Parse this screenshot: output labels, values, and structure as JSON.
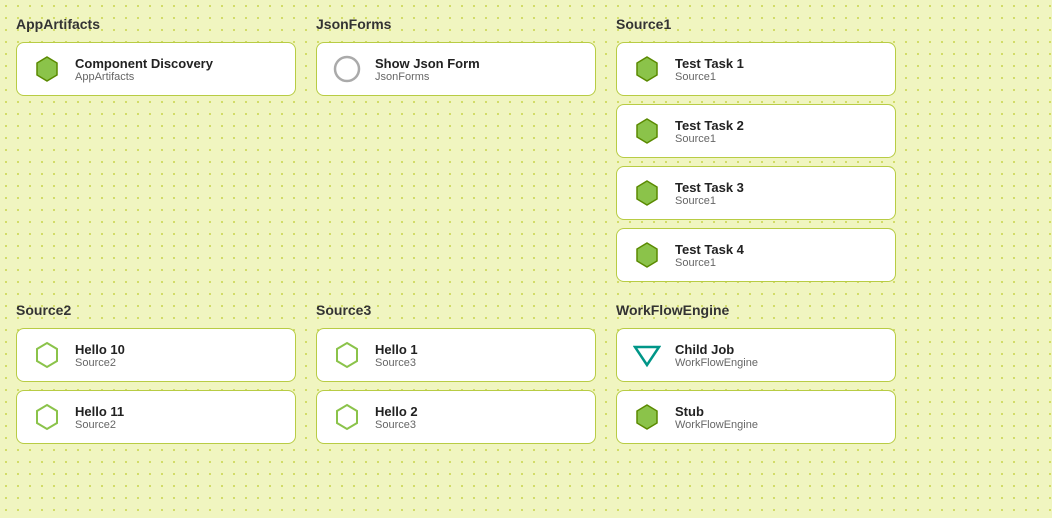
{
  "groups": [
    {
      "id": "app-artifacts",
      "title": "AppArtifacts",
      "iconType": "hex",
      "items": [
        {
          "title": "Component Discovery",
          "subtitle": "AppArtifacts",
          "iconType": "hex"
        }
      ]
    },
    {
      "id": "json-forms",
      "title": "JsonForms",
      "items": [
        {
          "title": "Show Json Form",
          "subtitle": "JsonForms",
          "iconType": "circle"
        }
      ]
    },
    {
      "id": "source1",
      "title": "Source1",
      "items": [
        {
          "title": "Test Task 1",
          "subtitle": "Source1",
          "iconType": "hex"
        },
        {
          "title": "Test Task 2",
          "subtitle": "Source1",
          "iconType": "hex"
        },
        {
          "title": "Test Task 3",
          "subtitle": "Source1",
          "iconType": "hex"
        },
        {
          "title": "Test Task 4",
          "subtitle": "Source1",
          "iconType": "hex"
        }
      ]
    },
    {
      "id": "source2",
      "title": "Source2",
      "items": [
        {
          "title": "Hello 10",
          "subtitle": "Source2",
          "iconType": "hex-outline"
        },
        {
          "title": "Hello 11",
          "subtitle": "Source2",
          "iconType": "hex-outline"
        }
      ]
    },
    {
      "id": "source3",
      "title": "Source3",
      "items": [
        {
          "title": "Hello 1",
          "subtitle": "Source3",
          "iconType": "hex-outline"
        },
        {
          "title": "Hello 2",
          "subtitle": "Source3",
          "iconType": "hex-outline"
        }
      ]
    },
    {
      "id": "workflow-engine",
      "title": "WorkFlowEngine",
      "items": [
        {
          "title": "Child Job",
          "subtitle": "WorkFlowEngine",
          "iconType": "triangle"
        },
        {
          "title": "Stub",
          "subtitle": "WorkFlowEngine",
          "iconType": "hex"
        }
      ]
    }
  ]
}
